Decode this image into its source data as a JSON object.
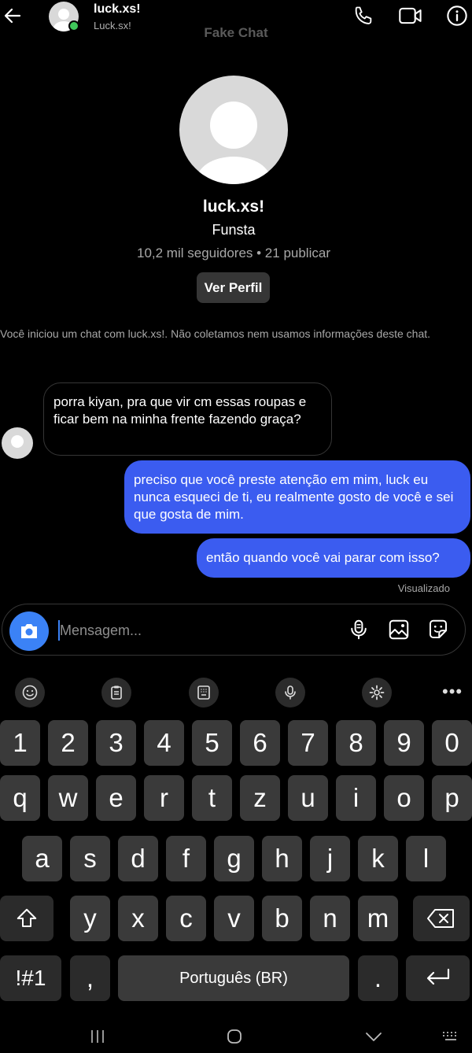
{
  "header": {
    "name": "luck.xs!",
    "username": "Luck.sx!",
    "watermark": "Fake Chat"
  },
  "profile": {
    "name": "luck.xs!",
    "subtitle": "Funsta",
    "stats": "10,2 mil seguidores • 21 publicar",
    "button": "Ver Perfil"
  },
  "notice": "Você iniciou um chat com luck.xs!. Não coletamos nem usamos informações deste chat.",
  "messages": [
    {
      "direction": "in",
      "text": "porra kiyan, pra que vir cm essas roupas e ficar bem na minha frente fazendo graça?"
    },
    {
      "direction": "out",
      "text": "preciso que você preste atenção em mim, luck eu nunca esqueci de ti, eu realmente gosto de você e sei que gosta de mim."
    },
    {
      "direction": "out",
      "text": "então quando você vai parar com isso?"
    }
  ],
  "seen_label": "Visualizado",
  "composer": {
    "placeholder": "Mensagem..."
  },
  "keyboard": {
    "row_numbers": [
      "1",
      "2",
      "3",
      "4",
      "5",
      "6",
      "7",
      "8",
      "9",
      "0"
    ],
    "row1": [
      "q",
      "w",
      "e",
      "r",
      "t",
      "z",
      "u",
      "i",
      "o",
      "p"
    ],
    "row2": [
      "a",
      "s",
      "d",
      "f",
      "g",
      "h",
      "j",
      "k",
      "l"
    ],
    "row3": [
      "y",
      "x",
      "c",
      "v",
      "b",
      "n",
      "m"
    ],
    "symbols": "!#1",
    "comma": ",",
    "space": "Português (BR)",
    "period": "."
  },
  "colors": {
    "accent_blue": "#3b5cf0",
    "camera_blue": "#3b82f6",
    "online_green": "#3fc75a"
  }
}
